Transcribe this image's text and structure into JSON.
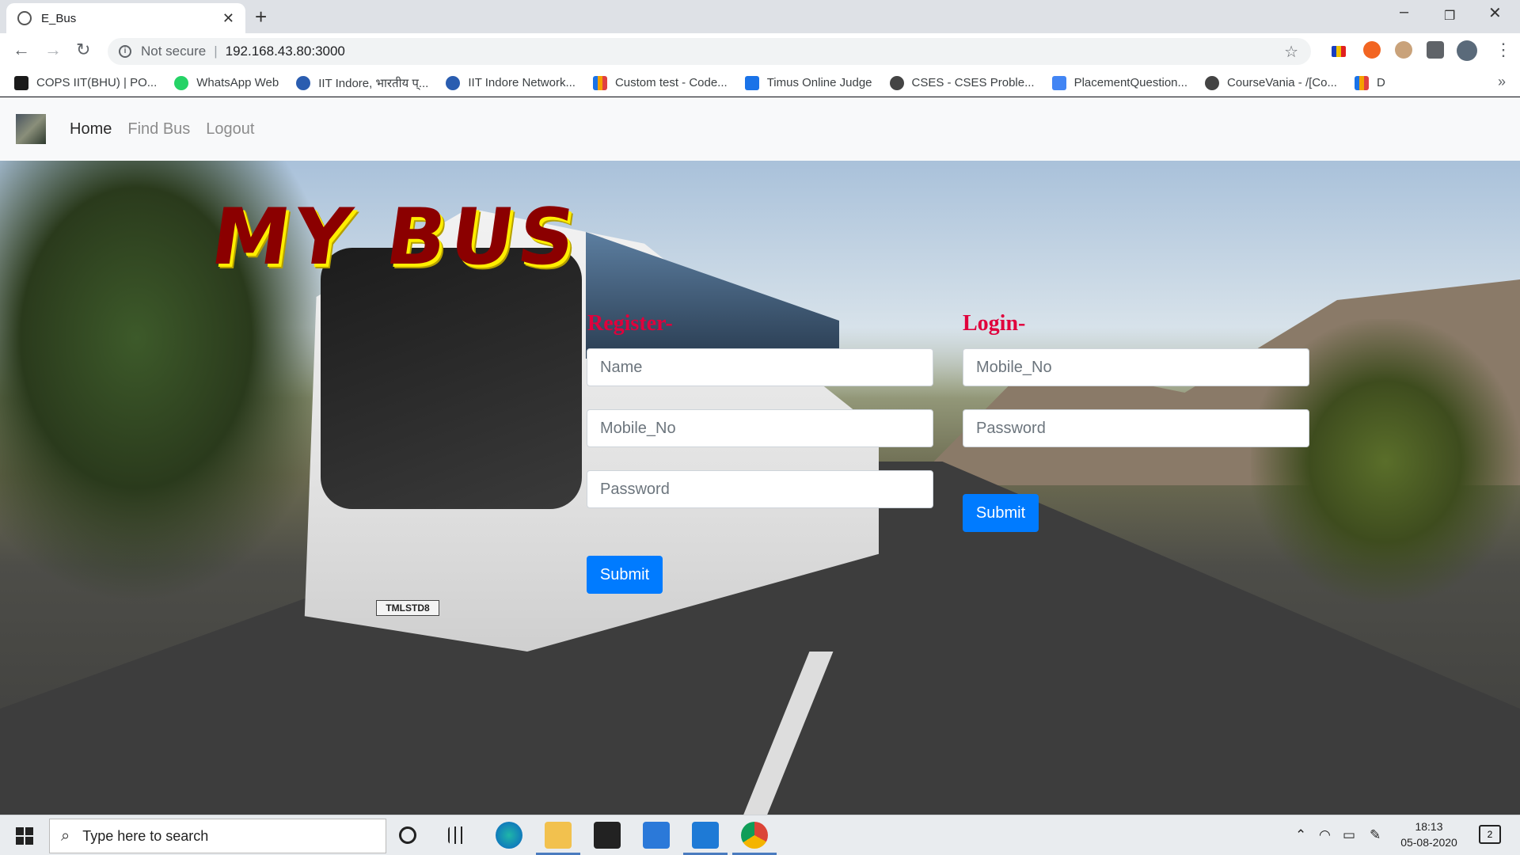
{
  "browser": {
    "tab_title": "E_Bus",
    "tab_close": "✕",
    "new_tab": "+",
    "address_security": "Not secure",
    "address_url": "192.168.43.80:3000",
    "bookmarks": [
      {
        "label": "COPS IIT(BHU) | PO...",
        "color": "#1a1a1a"
      },
      {
        "label": "WhatsApp Web",
        "color": "#25d366"
      },
      {
        "label": "IIT Indore, भारतीय प्...",
        "color": "#2a5db0"
      },
      {
        "label": "IIT Indore Network...",
        "color": "#2a5db0"
      },
      {
        "label": "Custom test - Code...",
        "color": "#f4a000"
      },
      {
        "label": "Timus Online Judge",
        "color": "#1a73e8"
      },
      {
        "label": "CSES - CSES Proble...",
        "color": "#444444"
      },
      {
        "label": "PlacementQuestion...",
        "color": "#4285f4"
      },
      {
        "label": "CourseVania - /[Co...",
        "color": "#444444"
      },
      {
        "label": "D",
        "color": "#f4a000"
      }
    ],
    "bookmarks_more": "»"
  },
  "site": {
    "nav": {
      "home": "Home",
      "find_bus": "Find Bus",
      "logout": "Logout"
    },
    "title": "MY BUS",
    "plate": "TMLSTD8",
    "register": {
      "heading": "Register-",
      "name_placeholder": "Name",
      "mobile_placeholder": "Mobile_No",
      "password_placeholder": "Password",
      "submit": "Submit"
    },
    "login": {
      "heading": "Login-",
      "mobile_placeholder": "Mobile_No",
      "password_placeholder": "Password",
      "submit": "Submit"
    }
  },
  "taskbar": {
    "search_placeholder": "Type here to search",
    "time": "18:13",
    "date": "05-08-2020",
    "notifications": "2"
  },
  "colors": {
    "primary_button": "#007bff",
    "form_heading": "#e0003c",
    "title_fill": "#8b0000",
    "title_outline": "#ffee00"
  }
}
